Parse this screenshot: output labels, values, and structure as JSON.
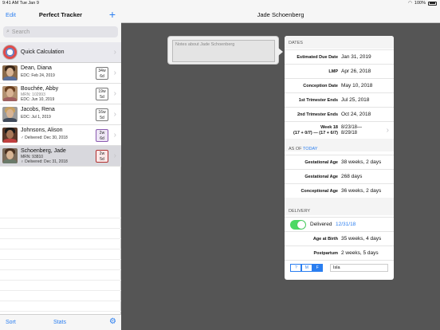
{
  "status": {
    "time": "9:41 AM",
    "date": "Tue Jan 9",
    "battery": "100%"
  },
  "sidebar": {
    "edit_label": "Edit",
    "title": "Perfect Tracker",
    "add_icon": "plus-icon",
    "search_placeholder": "Search",
    "quick_calc_label": "Quick Calculation",
    "patients": [
      {
        "name": "Dean, Diana",
        "line1": "EDC: Feb 24, 2019",
        "line2": "",
        "badge_top": "34w",
        "badge_bottom": "6d"
      },
      {
        "name": "Bouchée, Abby",
        "line1": "MRN: 102993",
        "line2": "EDC: Jun 10, 2019",
        "badge_top": "19w",
        "badge_bottom": "5d"
      },
      {
        "name": "Jacobs, Rena",
        "line1": "EDC: Jul 1, 2019",
        "line2": "",
        "badge_top": "16w",
        "badge_bottom": "5d"
      },
      {
        "name": "Johnsons, Alison",
        "line1": "♂ Delivered: Dec 30, 2018",
        "line2": "",
        "badge_top": "2w",
        "badge_bottom": "6d"
      },
      {
        "name": "Schoenberg, Jade",
        "line1": "MRN: 93810",
        "line2": "♀ Delivered: Dec 31, 2018",
        "badge_top": "2w",
        "badge_bottom": "5d"
      }
    ],
    "toolbar": {
      "sort_label": "Sort",
      "stats_label": "Stats",
      "gear_icon": "gear-icon"
    }
  },
  "detail": {
    "title": "Jade Schoenberg",
    "notes_placeholder": "Notes about Jade Schoenberg",
    "dates_header": "DATES",
    "dates": [
      {
        "label": "Estimated Due Date",
        "value": "Jan 31, 2019"
      },
      {
        "label": "LMP",
        "value": "Apr 26, 2018"
      },
      {
        "label": "Conception Date",
        "value": "May 10, 2018"
      },
      {
        "label": "1st Trimester Ends",
        "value": "Jul 25, 2018"
      },
      {
        "label": "2nd Trimester Ends",
        "value": "Oct 24, 2018"
      }
    ],
    "week_row": {
      "label1": "Week 18",
      "label2": "(17 + 0/7) — (17 + 6/7)",
      "value1": "8/23/18—",
      "value2": "8/29/18"
    },
    "as_of_prefix": "AS OF",
    "as_of_link": "TODAY",
    "asof": [
      {
        "label": "Gestational Age",
        "value": "38 weeks, 2 days"
      },
      {
        "label": "Gestational Age",
        "value": "268 days"
      },
      {
        "label": "Conceptional Age",
        "value": "36 weeks, 2 days"
      }
    ],
    "delivery_header": "DELIVERY",
    "delivered_label": "Delivered",
    "delivered_date": "12/31/18",
    "delivery": [
      {
        "label": "Age at Birth",
        "value": "35 weeks, 4 days"
      },
      {
        "label": "Postpartum",
        "value": "2 weeks, 5 days"
      }
    ],
    "sex_segments": [
      "?",
      "M",
      "F"
    ],
    "sex_selected": "F",
    "baby_name": "Isla"
  }
}
